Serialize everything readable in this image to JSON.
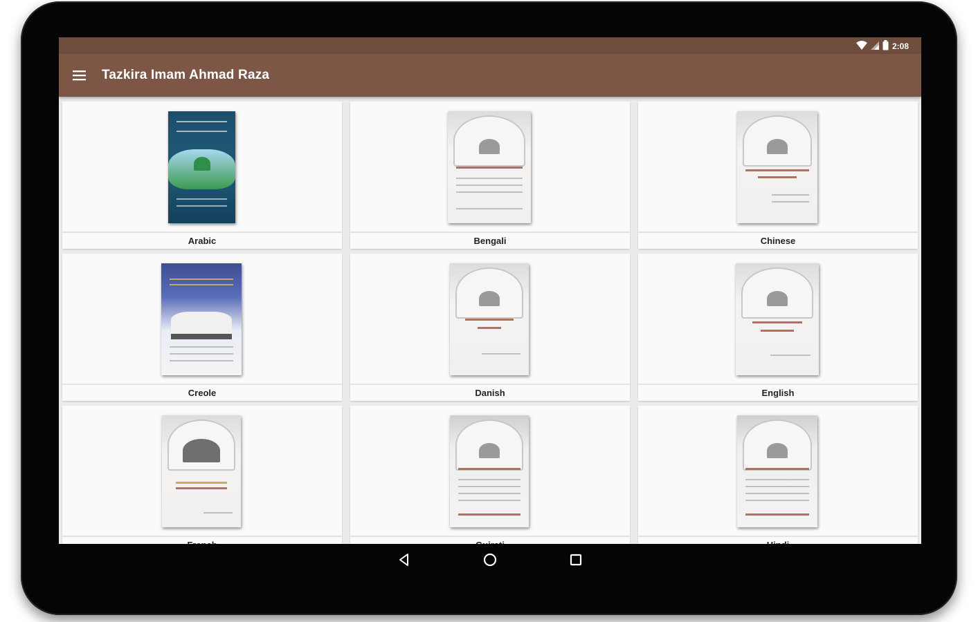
{
  "status_bar": {
    "time": "2:08",
    "icons": [
      "wifi-icon",
      "signal-icon",
      "battery-icon"
    ]
  },
  "app_bar": {
    "title": "Tazkira Imam Ahmad Raza",
    "menu_icon": "hamburger-menu-icon"
  },
  "books": [
    {
      "label": "Arabic"
    },
    {
      "label": "Bengali"
    },
    {
      "label": "Chinese"
    },
    {
      "label": "Creole"
    },
    {
      "label": "Danish"
    },
    {
      "label": "English"
    },
    {
      "label": "French"
    },
    {
      "label": "Gujrati"
    },
    {
      "label": "Hindi"
    }
  ],
  "nav_bar": {
    "back_icon": "back-triangle-icon",
    "home_icon": "home-circle-icon",
    "recents_icon": "recents-square-icon"
  },
  "colors": {
    "status_bar": "#6e4d3d",
    "app_bar": "#7d5646",
    "background": "#ebebeb",
    "card": "#fafafa"
  }
}
